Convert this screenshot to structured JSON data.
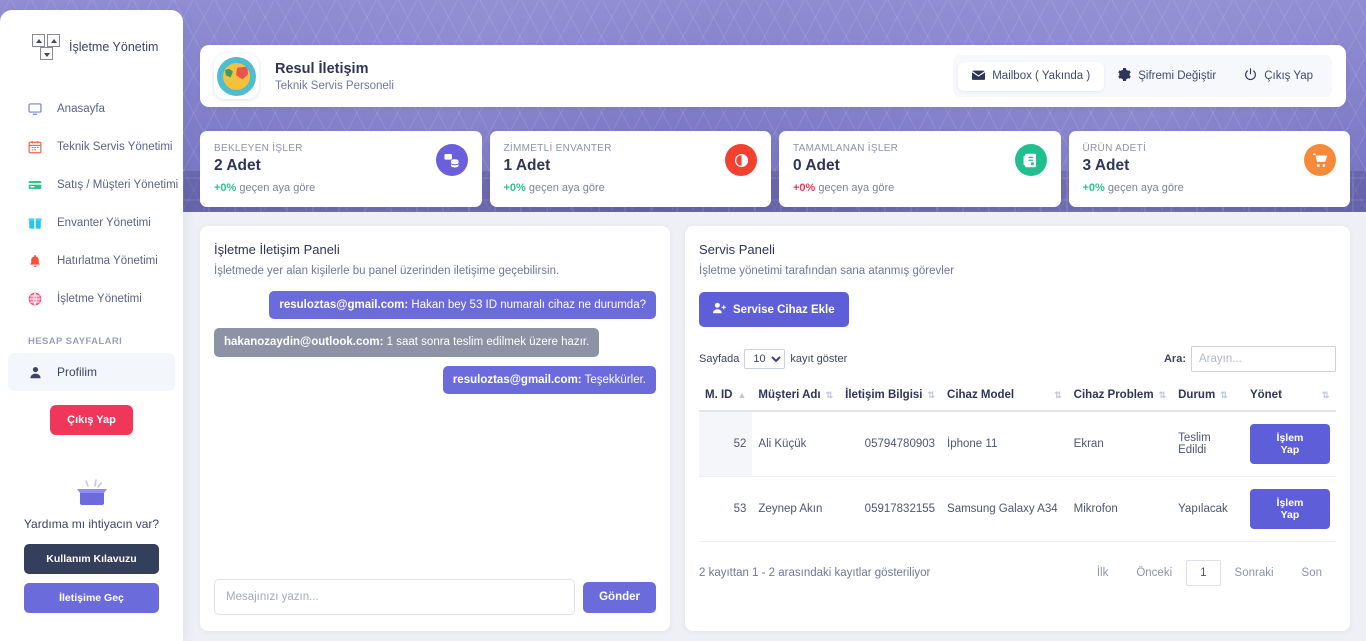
{
  "sidebar": {
    "brand": "İşletme Yönetim",
    "items": [
      {
        "label": "Anasayfa",
        "icon": "monitor-icon",
        "color": "#7b7fe0"
      },
      {
        "label": "Teknik Servis Yönetimi",
        "icon": "calendar-icon",
        "color": "#f4644b"
      },
      {
        "label": "Satış / Müşteri Yönetimi",
        "icon": "credit-card-icon",
        "color": "#2fc58a"
      },
      {
        "label": "Envanter Yönetimi",
        "icon": "box-icon",
        "color": "#2dc3e8"
      },
      {
        "label": "Hatırlatma Yönetimi",
        "icon": "bell-icon",
        "color": "#f4523f"
      },
      {
        "label": "İşletme Yönetimi",
        "icon": "globe-icon",
        "color": "#f24d7a"
      }
    ],
    "section_title": "HESAP SAYFALARI",
    "profile_item": {
      "label": "Profilim",
      "icon": "user-icon"
    },
    "logout_label": "Çıkış Yap",
    "help_text": "Yardıma mı ihtiyacın var?",
    "help_buttons": [
      {
        "label": "Kullanım Kılavuzu"
      },
      {
        "label": "İletişime Geç"
      }
    ]
  },
  "topbar": {
    "user_name": "Resul İletişim",
    "user_role": "Teknik Servis Personeli",
    "actions": [
      {
        "label": "Mailbox ( Yakında )",
        "icon": "mail-icon"
      },
      {
        "label": "Şifremi Değiştir",
        "icon": "gear-icon"
      },
      {
        "label": "Çıkış Yap",
        "icon": "power-icon"
      }
    ]
  },
  "stats": [
    {
      "label": "BEKLEYEN İŞLER",
      "value": "2 Adet",
      "delta": "+0%",
      "delta_color": "#2fc58a",
      "sub": "geçen aya göre",
      "icon": "stack-icon",
      "icon_bg": "#6c5fdc"
    },
    {
      "label": "ZİMMETLİ ENVANTER",
      "value": "1 Adet",
      "delta": "+0%",
      "delta_color": "#2fc58a",
      "sub": "geçen aya göre",
      "icon": "chart-icon",
      "icon_bg": "#f4402f"
    },
    {
      "label": "TAMAMLANAN İŞLER",
      "value": "0 Adet",
      "delta": "+0%",
      "delta_color": "#f0365a",
      "sub": "geçen aya göre",
      "icon": "clipboard-icon",
      "icon_bg": "#1fbf8f"
    },
    {
      "label": "ÜRÜN ADETİ",
      "value": "3 Adet",
      "delta": "+0%",
      "delta_color": "#2fc58a",
      "sub": "geçen aya göre",
      "icon": "cart-icon",
      "icon_bg": "#f7893b"
    }
  ],
  "chat_panel": {
    "title": "İşletme İletişim Paneli",
    "subtitle": "İşletmede yer alan kişilerle bu panel üzerinden iletişime geçebilirsin.",
    "messages": [
      {
        "side": "right",
        "sender": "resuloztas@gmail.com:",
        "text": " Hakan bey 53 ID numaralı cihaz ne durumda?"
      },
      {
        "side": "left",
        "sender": "hakanozaydin@outlook.com:",
        "text": " 1 saat sonra teslim edilmek üzere hazır."
      },
      {
        "side": "right",
        "sender": "resuloztas@gmail.com:",
        "text": " Teşekkürler."
      }
    ],
    "input_placeholder": "Mesajınızı yazın...",
    "send_label": "Gönder"
  },
  "service_panel": {
    "title": "Servis Paneli",
    "subtitle": "İşletme yönetimi tarafından sana atanmış görevler",
    "add_button": "Servise Cihaz Ekle",
    "length_prefix": "Sayfada",
    "length_value": "10",
    "length_suffix": "kayıt göster",
    "search_label": "Ara:",
    "search_placeholder": "Arayın...",
    "columns": [
      "M. ID",
      "Müşteri Adı",
      "İletişim Bilgisi",
      "Cihaz Model",
      "Cihaz Problem",
      "Durum",
      "Yönet"
    ],
    "rows": [
      {
        "id": "52",
        "customer": "Ali Küçük",
        "contact": "05794780903",
        "model": "İphone 11",
        "problem": "Ekran",
        "status": "Teslim Edildi",
        "action": "İşlem Yap"
      },
      {
        "id": "53",
        "customer": "Zeynep Akın",
        "contact": "05917832155",
        "model": "Samsung Galaxy A34",
        "problem": "Mikrofon",
        "status": "Yapılacak",
        "action": "İşlem Yap"
      }
    ],
    "footer_info": "2 kayıttan 1 - 2 arasındaki kayıtlar gösteriliyor",
    "pagination": [
      "İlk",
      "Önceki",
      "1",
      "Sonraki",
      "Son"
    ],
    "current_page": "1"
  }
}
